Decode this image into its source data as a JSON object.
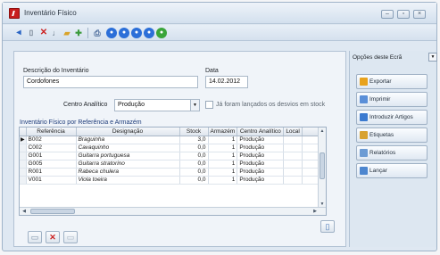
{
  "window": {
    "title": "Inventário Físico",
    "min_symbol": "–",
    "max_symbol": "▫",
    "close_symbol": "×"
  },
  "toolbar": {
    "icons": [
      "back-arrow-icon",
      "new-document-icon",
      "delete-icon",
      "tools-icon",
      "folder-icon",
      "tag-icon",
      "print-preview-icon",
      "first-record-icon",
      "previous-record-icon",
      "next-record-icon",
      "last-record-icon",
      "refresh-icon"
    ],
    "nav_glyph": "●"
  },
  "form": {
    "description_label": "Descrição do Inventário",
    "description_value": "Cordofones",
    "date_label": "Data",
    "date_value": "14.02.2012",
    "cost_center_label": "Centro Analítico",
    "cost_center_value": "Produção",
    "deviations_label": "Já foram lançados os desvios em stock",
    "grid_title": "Inventário Físico por Referência e Armazém"
  },
  "grid": {
    "columns": [
      "Referência",
      "Designação",
      "Stock",
      "Armazém",
      "Centro Analítico",
      "Local"
    ],
    "current_row_marker": "▶",
    "rows": [
      {
        "ref": "B002",
        "desc": "Braguinha",
        "stock": "3,0",
        "wh": "1",
        "cc": "Produção",
        "loc": ""
      },
      {
        "ref": "C002",
        "desc": "Cavaquinho",
        "stock": "0,0",
        "wh": "1",
        "cc": "Produção",
        "loc": ""
      },
      {
        "ref": "G001",
        "desc": "Guitarra portuguesa",
        "stock": "0,0",
        "wh": "1",
        "cc": "Produção",
        "loc": ""
      },
      {
        "ref": "G005",
        "desc": "Guitarra stratorino",
        "stock": "0,0",
        "wh": "1",
        "cc": "Produção",
        "loc": ""
      },
      {
        "ref": "R001",
        "desc": "Rabeca chulera",
        "stock": "0,0",
        "wh": "1",
        "cc": "Produção",
        "loc": ""
      },
      {
        "ref": "V001",
        "desc": "Viola toeira",
        "stock": "0,0",
        "wh": "1",
        "cc": "Produção",
        "loc": ""
      }
    ]
  },
  "side_panel": {
    "title": "Opções deste Ecrã",
    "actions": [
      {
        "label": "Exportar",
        "icon": "export-icon",
        "color": "#e8a21c"
      },
      {
        "label": "Imprimir",
        "icon": "print-icon",
        "color": "#5a8fd8"
      },
      {
        "label": "Introduzir Artigos",
        "icon": "add-items-icon",
        "color": "#3b7ad0"
      },
      {
        "label": "Etiquetas",
        "icon": "labels-icon",
        "color": "#d8a230"
      },
      {
        "label": "Relatórios",
        "icon": "reports-icon",
        "color": "#6c9bd4"
      },
      {
        "label": "Lançar",
        "icon": "post-icon",
        "color": "#4d86cf"
      }
    ]
  },
  "bottom_buttons": {
    "add_symbol": "▭",
    "delete_symbol": "✕",
    "other_symbol": "▭",
    "right_symbol": "▯"
  }
}
